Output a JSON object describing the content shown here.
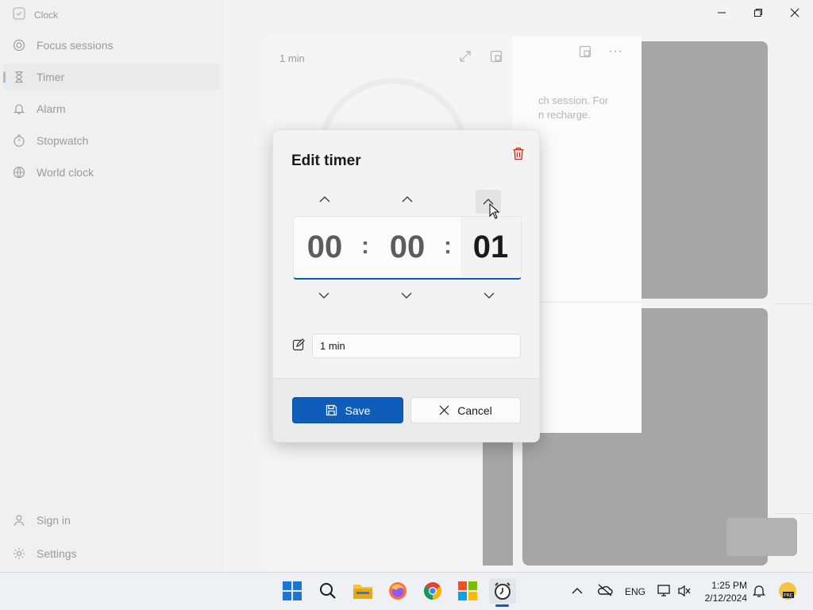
{
  "app": {
    "title": "Clock",
    "nav": [
      {
        "label": "Focus sessions",
        "icon": "focus-icon"
      },
      {
        "label": "Timer",
        "icon": "hourglass-icon",
        "selected": true
      },
      {
        "label": "Alarm",
        "icon": "bell-icon"
      },
      {
        "label": "Stopwatch",
        "icon": "stopwatch-icon"
      },
      {
        "label": "World clock",
        "icon": "globe-icon"
      }
    ],
    "bottom_nav": [
      {
        "label": "Sign in",
        "icon": "person-icon"
      },
      {
        "label": "Settings",
        "icon": "gear-icon"
      }
    ]
  },
  "background": {
    "timer_card_label": "1 min",
    "focus_text_line1": "ch session. For",
    "focus_text_line2": "n recharge."
  },
  "dialog": {
    "title": "Edit timer",
    "hours": "00",
    "minutes": "00",
    "seconds": "01",
    "separator": ":",
    "name_value": "1 min",
    "save_label": "Save",
    "cancel_label": "Cancel"
  },
  "taskbar": {
    "language": "ENG",
    "time": "1:25 PM",
    "date": "2/12/2024"
  },
  "colors": {
    "accent": "#0f5db8",
    "underline": "#005fb8",
    "delete_icon": "#c42b1c"
  }
}
